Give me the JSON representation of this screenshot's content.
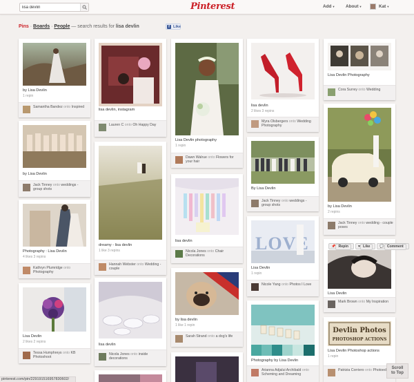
{
  "header": {
    "search_value": "lisa devlin",
    "logo": "Pinterest",
    "add_label": "Add",
    "about_label": "About",
    "user_label": "Kat"
  },
  "subnav": {
    "pins": "Pins",
    "sep1": " · ",
    "boards": "Boards",
    "sep2": " · ",
    "people": "People",
    "search_prefix": " — search results for ",
    "query": "lisa devlin",
    "like": "Like"
  },
  "pins": [
    {
      "desc": "by Lisa Devlin",
      "stats": "1 repin",
      "user": "Samantha Bandez",
      "verb": "onto",
      "board": "Inspired"
    },
    {
      "desc": "by Lisa Devlin",
      "stats": "",
      "user": "Jack Tinney",
      "verb": "onto",
      "board": "weddings - group shots"
    },
    {
      "desc": "Photography : Lisa Devlin",
      "stats": "4 likes   3 repins",
      "user": "Kathryn Plumridge",
      "verb": "onto",
      "board": "Photography"
    },
    {
      "desc": "Lisa Devlin",
      "stats": "2 likes   2 repins",
      "user": "Tessa Humphreys",
      "verb": "onto",
      "board": "KB Photoshoot"
    },
    {
      "desc": "lisa devlin, instagram",
      "stats": "",
      "user": "Lauren C",
      "verb": "onto",
      "board": "Oh Happy Day"
    },
    {
      "desc": "dreamy - lisa devlin",
      "stats": "1 like   3 repins",
      "user": "Hannah Webster",
      "verb": "onto",
      "board": "Wedding - couple"
    },
    {
      "desc": "lisa devlin",
      "stats": "",
      "user": "Nicola Jones",
      "verb": "onto",
      "board": "inside decorations"
    },
    {
      "desc": "Lisa Devlin photography",
      "stats": "1 repin",
      "user": "Dawn Walrue",
      "verb": "onto",
      "board": "Flowers for your hair"
    },
    {
      "desc": "lisa devlin",
      "stats": "",
      "user": "Nicola Jones",
      "verb": "onto",
      "board": "Chair Decorations"
    },
    {
      "desc": "by lisa devlin",
      "stats": "1 like   1 repin",
      "user": "Sarah Strand",
      "verb": "onto",
      "board": "a dog's life"
    },
    {
      "desc": "lisa devlin",
      "stats": "2 likes   3 repins",
      "user": "Myra Olsbergers",
      "verb": "onto",
      "board": "Wedding Photography"
    },
    {
      "desc": "By Lisa Devlin",
      "stats": "",
      "user": "Jack Tinney",
      "verb": "onto",
      "board": "weddings - group shots"
    },
    {
      "desc": "Lisa Devlin",
      "stats": "1 repin",
      "user": "Nicole Yang",
      "verb": "onto",
      "board": "Photos I Love"
    },
    {
      "desc": "Photography by Lisa Devlin",
      "stats": "",
      "user": "Arianna Adjalui Archibald",
      "verb": "onto",
      "board": "Scheming and Dreaming"
    },
    {
      "desc": "Lisa Devlin Photography",
      "stats": "",
      "user": "Cora Surrey",
      "verb": "onto",
      "board": "Wedding"
    },
    {
      "desc": "by Lisa Devlin",
      "stats": "2 repins",
      "user": "Jack Tinney",
      "verb": "onto",
      "board": "wedding - couple poses"
    },
    {
      "desc": "Lisa Devlin",
      "stats": "",
      "user": "Mark Brown",
      "verb": "onto",
      "board": "My Inspiration"
    },
    {
      "desc": "Lisa Devlin Photoshop actions",
      "stats": "1 repin",
      "user": "Patrizia Corriero",
      "verb": "onto",
      "board": "Photoediting"
    }
  ],
  "pin_actions": {
    "repin": "Repin",
    "like": "Like",
    "comment": "Comment"
  },
  "hover_image_text": {
    "line1": "Devlin Photos",
    "line2": "PHOTOSHOP ACTIONS"
  },
  "love_text": "LOVE",
  "scroll_top": {
    "line1": "Scroll",
    "line2": "to Top"
  },
  "status_url": "pinterest.com/pin/229191516957830602/"
}
